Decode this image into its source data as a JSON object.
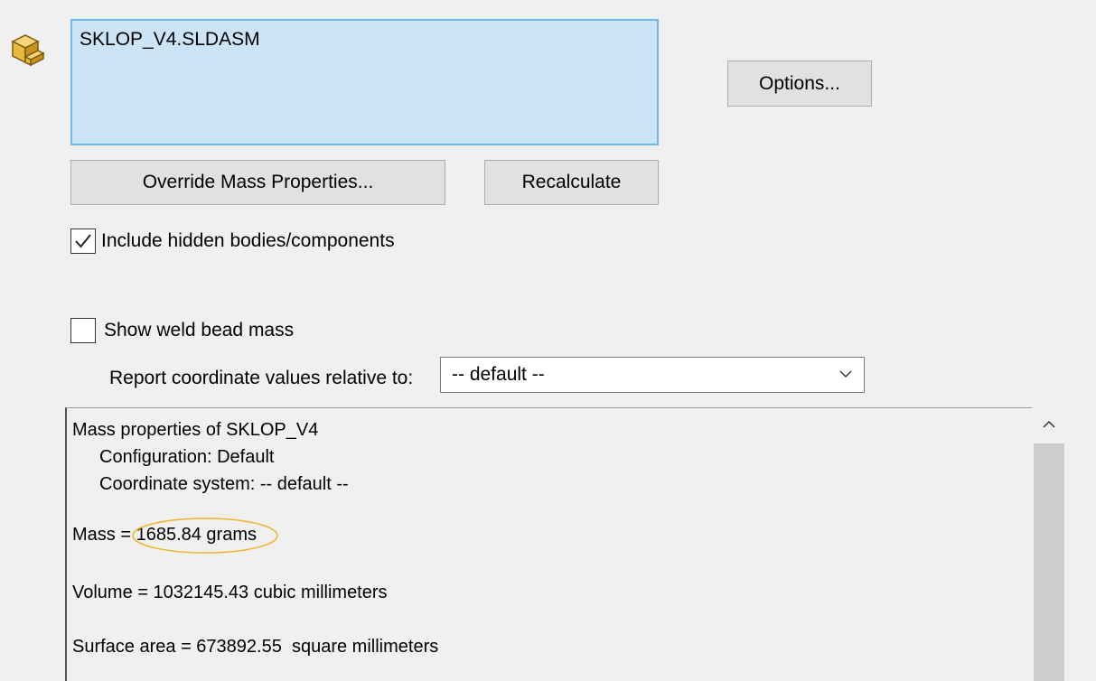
{
  "selection": {
    "items": [
      "SKLOP_V4.SLDASM"
    ]
  },
  "buttons": {
    "options": "Options...",
    "override_mass": "Override Mass Properties...",
    "recalculate": "Recalculate"
  },
  "checkboxes": {
    "include_hidden": {
      "label": "Include hidden bodies/components",
      "checked": true
    },
    "show_weld": {
      "label": "Show weld bead mass",
      "checked": false
    }
  },
  "coordinate": {
    "label": "Report coordinate values relative to:",
    "selected": "-- default --"
  },
  "results": {
    "title": "Mass properties of SKLOP_V4",
    "configuration": "Configuration: Default",
    "coordinate_system": "Coordinate system: -- default --",
    "mass_prefix": "Mass = ",
    "mass_value": "1685.84 grams",
    "volume": "Volume = 1032145.43 cubic millimeters",
    "surface_area": "Surface area = 673892.55  square millimeters"
  },
  "colors": {
    "selection_bg": "#cce4f7",
    "selection_border": "#6fb8ec",
    "highlight_ellipse": "#f0b429",
    "dialog_bg": "#f0f0f0"
  },
  "icons": {
    "assembly": "assembly-icon",
    "checkmark": "checkmark-icon",
    "dropdown": "chevron-down-icon",
    "scroll_up": "chevron-up-icon"
  }
}
